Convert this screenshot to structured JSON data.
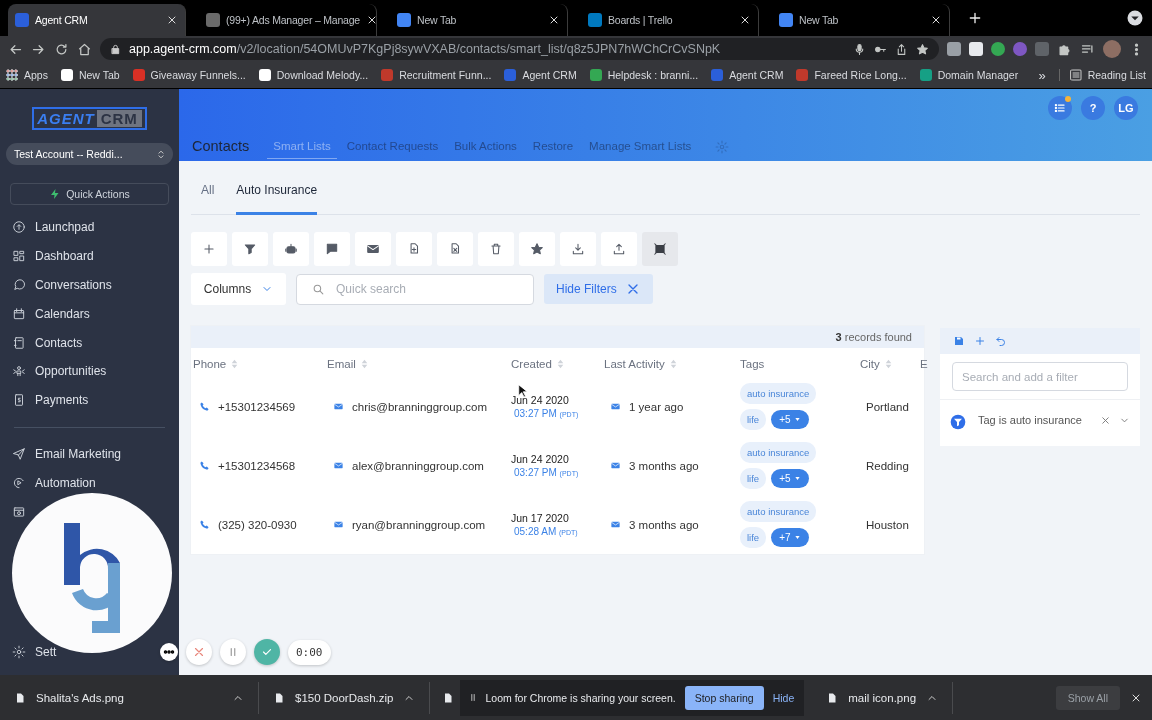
{
  "browser": {
    "tabs": [
      {
        "title": "Agent CRM",
        "selected": true
      },
      {
        "title": "(99+) Ads Manager – Manage",
        "selected": false
      },
      {
        "title": "New Tab",
        "selected": false
      },
      {
        "title": "Boards | Trello",
        "selected": false
      },
      {
        "title": "New Tab",
        "selected": false
      }
    ],
    "url": "**app.agent-crm.com**/v2/location/54OMUvP7KgPj8sywVXAB/contacts/smart_list/q8z5JPN7hWChCrCvSNpK",
    "bookmarks": [
      "Apps",
      "New Tab",
      "Giveaway Funnels...",
      "Download Melody...",
      "Recruitment Funn...",
      "Agent CRM",
      "Helpdesk : branni...",
      "Agent CRM",
      "Fareed Rice Long...",
      "Domain Manager"
    ],
    "bookmarks_more": "»",
    "reading_list": "Reading List"
  },
  "sidebar": {
    "logo": {
      "left": "AGENT",
      "right": "CRM"
    },
    "account": "Test Account -- Reddi...",
    "quick_actions": "Quick Actions",
    "items": [
      {
        "label": "Launchpad"
      },
      {
        "label": "Dashboard"
      },
      {
        "label": "Conversations"
      },
      {
        "label": "Calendars"
      },
      {
        "label": "Contacts"
      },
      {
        "label": "Opportunities"
      },
      {
        "label": "Payments"
      }
    ],
    "items2": [
      {
        "label": "Email Marketing"
      },
      {
        "label": "Automation"
      }
    ],
    "settings_label": "Sett"
  },
  "header": {
    "title": "Contacts",
    "nav": [
      {
        "label": "Smart Lists",
        "selected": true
      },
      {
        "label": "Contact Requests",
        "selected": false
      },
      {
        "label": "Bulk Actions",
        "selected": false
      },
      {
        "label": "Restore",
        "selected": false
      },
      {
        "label": "Manage Smart Lists",
        "selected": false
      }
    ],
    "notification_dot": true,
    "help": "?",
    "avatar": "LG"
  },
  "list_tabs": [
    {
      "label": "All",
      "selected": false
    },
    {
      "label": "Auto Insurance",
      "selected": true
    }
  ],
  "toolbar": [
    {
      "selected": false
    },
    {
      "selected": false
    },
    {
      "selected": false
    },
    {
      "selected": false
    },
    {
      "selected": false
    },
    {
      "selected": false
    },
    {
      "selected": false
    },
    {
      "selected": false
    },
    {
      "selected": false
    },
    {
      "selected": false
    },
    {
      "selected": false
    },
    {
      "selected": true
    }
  ],
  "columns_button": "Columns",
  "search": {
    "placeholder": "Quick search"
  },
  "hide_filters": "Hide Filters",
  "table": {
    "records": "**3** records found",
    "columns": [
      {
        "label": "Phone",
        "sortable": true
      },
      {
        "label": "Email",
        "sortable": true
      },
      {
        "label": "Created",
        "sortable": true
      },
      {
        "label": "Last Activity",
        "sortable": true
      },
      {
        "label": "Tags",
        "sortable": false
      },
      {
        "label": "City",
        "sortable": true
      },
      {
        "label": "E",
        "sortable": false
      }
    ],
    "rows": [
      {
        "phone": "+15301234569",
        "email": "chris@branninggroup.com",
        "date": "Jun 24 2020",
        "time": "03:27 PM",
        "tz": "(PDT)",
        "activity": "1 year ago",
        "tags": [
          "auto insurance",
          "life"
        ],
        "more": "+5",
        "city": "Portland"
      },
      {
        "phone": "+15301234568",
        "email": "alex@branninggroup.com",
        "date": "Jun 24 2020",
        "time": "03:27 PM",
        "tz": "(PDT)",
        "activity": "3 months ago",
        "tags": [
          "auto insurance",
          "life"
        ],
        "more": "+5",
        "city": "Redding"
      },
      {
        "phone": "(325) 320-0930",
        "email": "ryan@branninggroup.com",
        "date": "Jun 17 2020",
        "time": "05:28 AM",
        "tz": "(PDT)",
        "activity": "3 months ago",
        "tags": [
          "auto insurance",
          "life"
        ],
        "more": "+7",
        "city": "Houston"
      }
    ]
  },
  "filters": {
    "placeholder": "Search and add a filter",
    "items": [
      {
        "label": "Tag is auto insurance"
      }
    ]
  },
  "loom": {
    "timer": "0:00"
  },
  "downloads": {
    "items": [
      {
        "name": "Shalita's Ads.png"
      },
      {
        "name": "$150 DoorDash.zip"
      }
    ],
    "notice": {
      "text": "Loom for Chrome is sharing your screen.",
      "stop": "Stop sharing",
      "hide": "Hide"
    },
    "after": [
      {
        "name": "mail icon.png"
      }
    ],
    "show_all": "Show All"
  }
}
